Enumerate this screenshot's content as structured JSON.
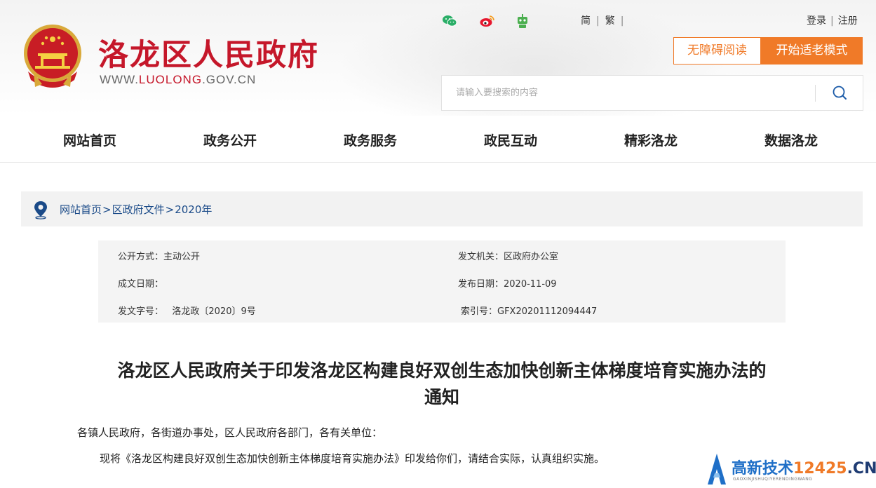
{
  "header": {
    "site_title": "洛龙区人民政府",
    "site_url_prefix": "WWW.",
    "site_url_highlight": "LUOLONG",
    "site_url_suffix": ".GOV.CN",
    "lang_simplified": "简",
    "lang_traditional": "繁",
    "login": "登录",
    "register": "注册",
    "accessible_reading": "无障碍阅读",
    "elder_mode": "开始适老模式",
    "search_placeholder": "请输入要搜索的内容",
    "colors": {
      "brand_red": "#c5172a",
      "accent_orange": "#f07a28"
    },
    "social_icons": [
      "wechat-icon",
      "weibo-icon",
      "robot-icon"
    ]
  },
  "nav": {
    "items": [
      "网站首页",
      "政务公开",
      "政务服务",
      "政民互动",
      "精彩洛龙",
      "数据洛龙"
    ]
  },
  "breadcrumb": {
    "items": [
      "网站首页",
      "区政府文件",
      "2020年"
    ],
    "separator": ">"
  },
  "info": {
    "open_mode": "公开方式：主动公开",
    "issuer": "发文机关：区政府办公室",
    "created_date": "成文日期：",
    "publish_date": "发布日期：2020-11-09",
    "doc_number": "发文字号：   洛龙政〔2020〕9号",
    "index_number": "索引号：GFX20201112094447"
  },
  "article": {
    "title_line1": "洛龙区人民政府关于印发洛龙区构建良好双创生态加快创新主体梯度培育实施办法的",
    "title_line2": "通知",
    "salutation": "各镇人民政府，各街道办事处，区人民政府各部门，各有关单位：",
    "body": "现将《洛龙区构建良好双创生态加快创新主体梯度培育实施办法》印发给你们，请结合实际，认真组织实施。"
  },
  "watermark": {
    "main": "高新技术",
    "domain": "12425",
    "tld": ".CN",
    "sub": "GAOXINJISHUQIYERENDINGWANG"
  }
}
